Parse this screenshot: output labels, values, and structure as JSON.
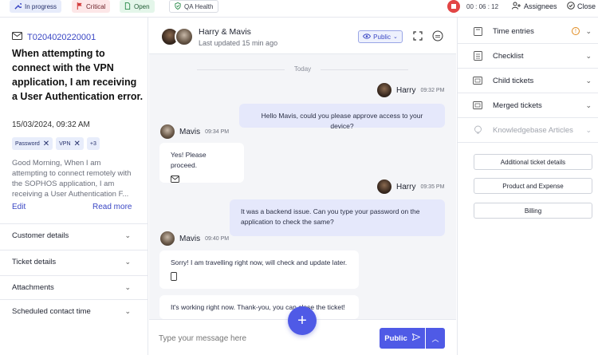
{
  "topbar": {
    "tags": [
      {
        "label": "In progress",
        "icon": "wrench-icon"
      },
      {
        "label": "Critical",
        "icon": "flag-icon"
      },
      {
        "label": "Open",
        "icon": "file-icon"
      },
      {
        "label": "QA Health",
        "icon": "shield-icon"
      }
    ],
    "timer": "00 : 06 : 12",
    "assignees_label": "Assignees",
    "close_label": "Close"
  },
  "ticket": {
    "id": "T0204020220001",
    "title": "When attempting to connect with the VPN application, I am receiving a User Authentication error.",
    "date": "15/03/2024, 09:32 AM",
    "chips": [
      "Password",
      "VPN",
      "+3"
    ],
    "description": "Good Morning,  When I am attempting to connect remotely with the SOPHOS application, I am receiving a User Authentication F...",
    "edit_label": "Edit",
    "read_more_label": "Read more"
  },
  "left_sections": [
    "Customer details",
    "Ticket details",
    "Attachments",
    "Scheduled contact time"
  ],
  "chat": {
    "title": "Harry & Mavis",
    "updated": "Last updated 15 min ago",
    "visibility": "Public",
    "divider": "Today",
    "messages": [
      {
        "sender": "Harry",
        "time": "09:32 PM",
        "text": "Hello Mavis, could you please approve access to your device?"
      },
      {
        "sender": "Mavis",
        "time": "09:34 PM",
        "text": "Yes! Please proceed."
      },
      {
        "sender": "Harry",
        "time": "09:35 PM",
        "text": "It was a backend issue. Can you type your password on the application to check the same?"
      },
      {
        "sender": "Mavis",
        "time": "09:40 PM",
        "text": "Sorry! I am travelling right now, will check and update later."
      },
      {
        "sender": "",
        "time": "",
        "text": "It's working right now. Thank-you, you can close the ticket!"
      }
    ],
    "composer_placeholder": "Type your message here",
    "send_label": "Public",
    "fab_label": "+"
  },
  "right_panel": {
    "items": [
      {
        "label": "Time entries",
        "icon": "clipboard-icon"
      },
      {
        "label": "Checklist",
        "icon": "checklist-icon"
      },
      {
        "label": "Child tickets",
        "icon": "ticket-icon"
      },
      {
        "label": "Merged tickets",
        "icon": "merge-icon"
      },
      {
        "label": "Knowledgebase Articles",
        "icon": "lightbulb-icon"
      }
    ],
    "buttons": [
      "Additional ticket details",
      "Product and Expense",
      "Billing"
    ]
  },
  "colors": {
    "accent": "#4f5ae6",
    "link": "#3a47c4",
    "critical": "#e24545"
  }
}
